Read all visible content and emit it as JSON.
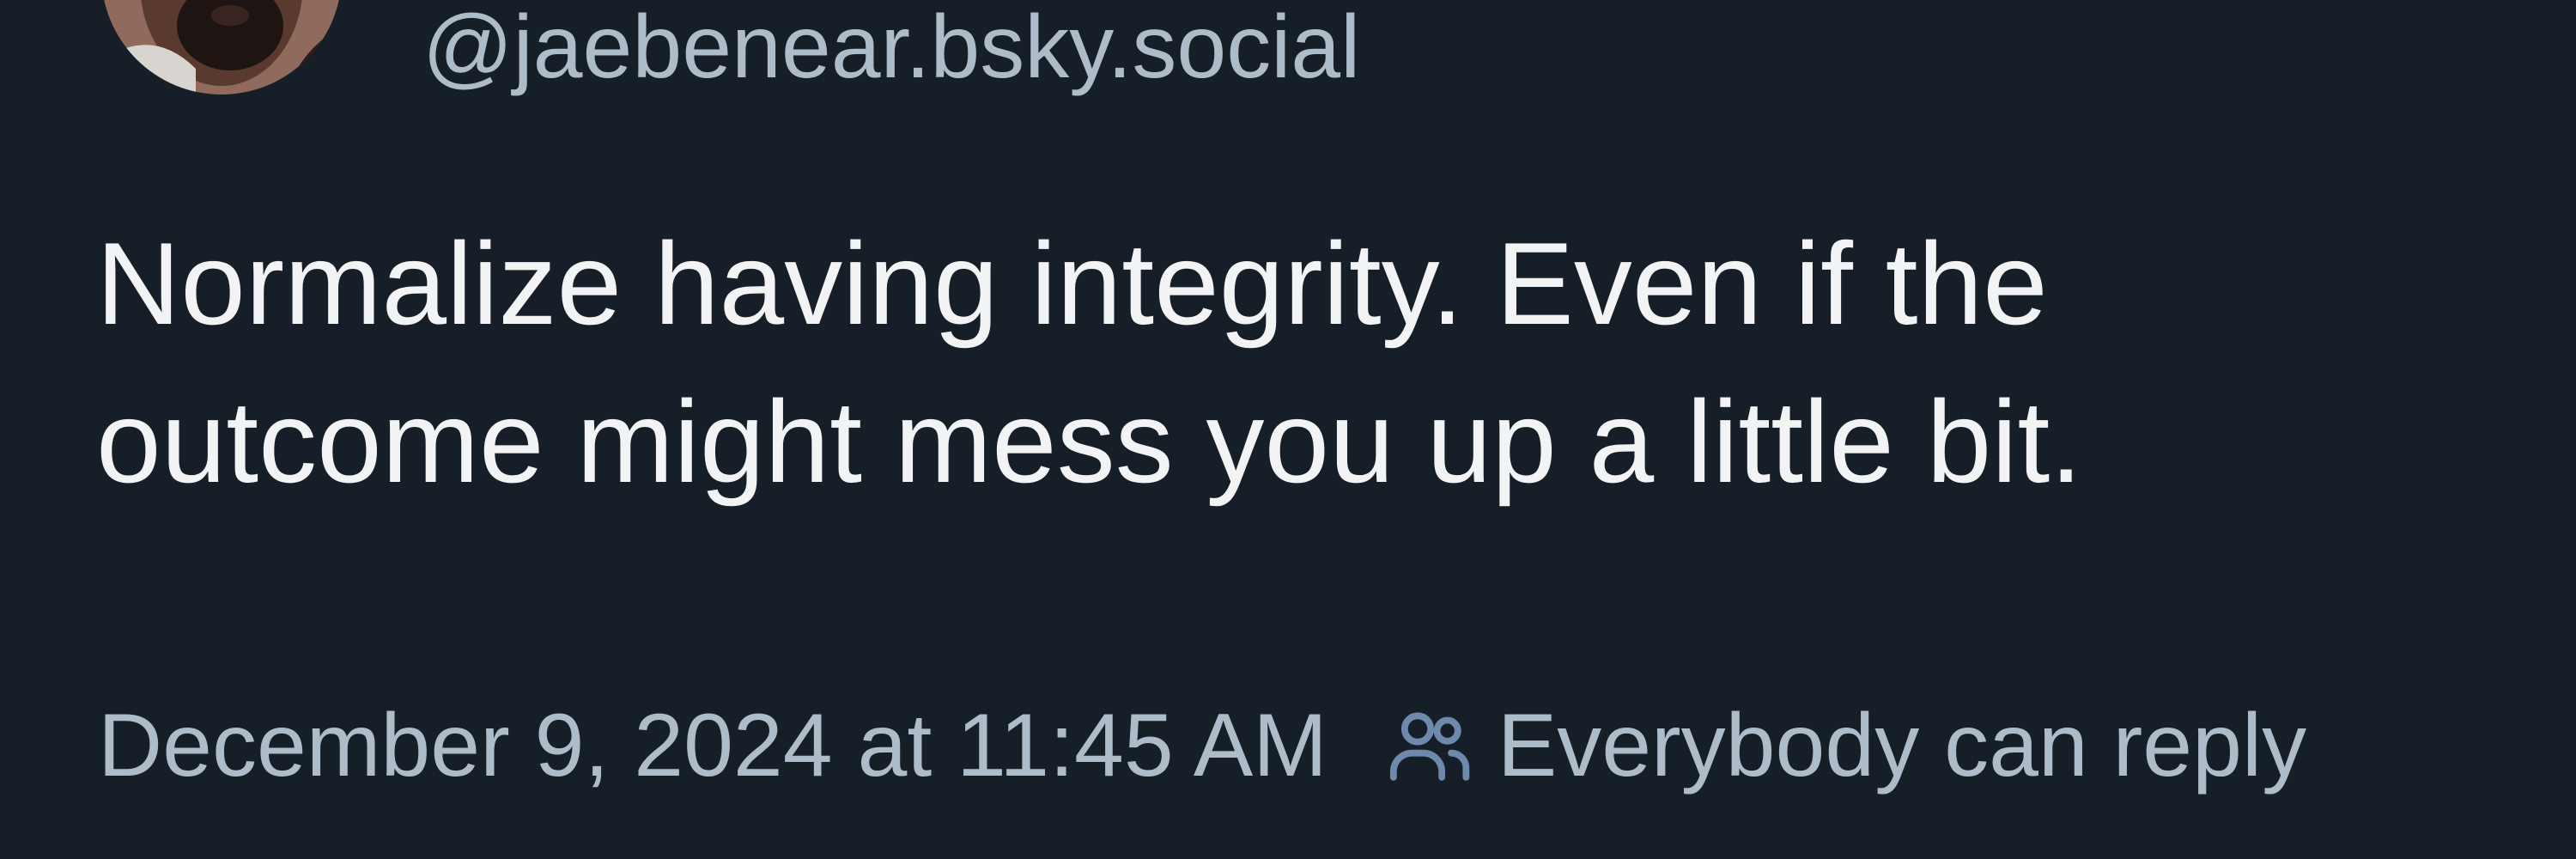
{
  "post": {
    "handle": "@jaebenear.bsky.social",
    "text": "Normalize having integrity. Even if the outcome might mess you up a little bit.",
    "timestamp": "December 9, 2024 at 11:45 AM",
    "reply_setting": "Everybody can reply",
    "reply_icon": "people-icon"
  },
  "colors": {
    "background": "#161e27",
    "primary_text": "#f1f3f5",
    "secondary_text": "#aebbc9",
    "icon": "#6f89ad"
  }
}
